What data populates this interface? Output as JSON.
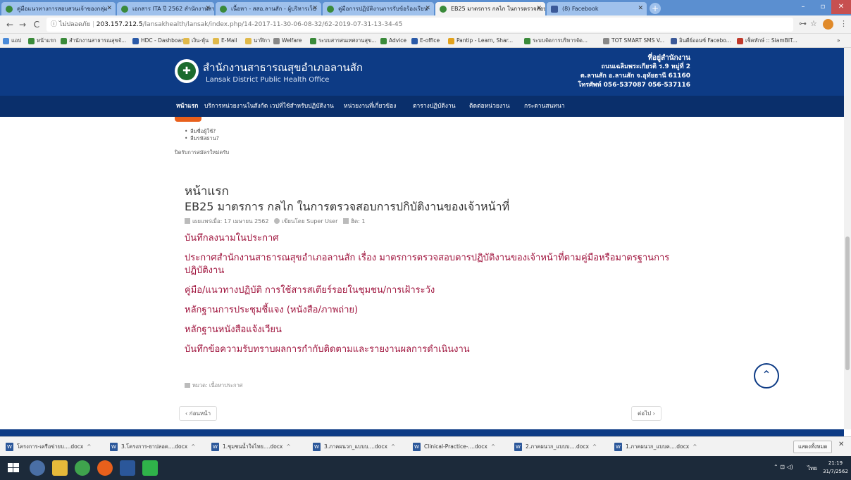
{
  "browser": {
    "tabs": [
      {
        "label": "คู่มือแนวทางการสอบสวนเจ้าของกลุ่ม",
        "fav": "site"
      },
      {
        "label": "เอกสาร ITA ปี 2562 สำนักงานสาธาร",
        "fav": "site"
      },
      {
        "label": "เนื้อหา - สสอ.ลานสัก - ผู้บริหารเว็บ",
        "fav": "site"
      },
      {
        "label": "คู่มือการปฏิบัติงานการรับข้อร้องเรียน",
        "fav": "site"
      },
      {
        "label": "EB25 มาตรการ กลไก ในการตรวจสอบ",
        "fav": "site"
      },
      {
        "label": "(8) Facebook",
        "fav": "fb"
      }
    ],
    "new_tab_symbol": "+",
    "window_controls": {
      "minimize": "–",
      "maximize": "▫",
      "close": "✕"
    },
    "nav": {
      "back": "←",
      "forward": "→",
      "reload": "C"
    },
    "url": {
      "security": "ⓘ ไม่ปลอดภัย",
      "host": "203.157.212.5",
      "path": "/lansakhealth/lansak/index.php/14-2017-11-30-06-08-32/62-2019-07-31-13-34-45"
    },
    "addr_icons": {
      "key": "⊶",
      "star": "☆",
      "menu": "⋮"
    },
    "bookmarks": [
      "แอป",
      "หน้าแรก",
      "สำนักงานสาธารณสุขจั...",
      "HDC - Dashboard",
      "เงิน-หุ้น",
      "E-Mail",
      "นาฬิกา",
      "Welfare",
      "ระบบสารสนเทศงานสุข...",
      "Advice",
      "E-office",
      "Pantip - Learn, Shar...",
      "ระบบจัดการบริหารจัด...",
      "TOT SMART SMS V...",
      "อินดีย์ออนซ์ Facebo...",
      "เช็คทักษ์ :: SiamBIT..."
    ],
    "bookmarks_more": "»"
  },
  "site": {
    "title": "สำนักงานสาธารณสุขอำเภอลานสัก",
    "subtitle": "Lansak District Public Health Office",
    "address": {
      "heading": "ที่อยู่สำนักงาน",
      "line1": "ถนนเฉลิมพระเกียรติ ร.9 หมู่ที่ 2",
      "line2": "ต.ลานสัก อ.ลานสัก จ.อุทัยธานี 61160",
      "line3": "โทรศัพท์ 056-537087 056-537116"
    },
    "nav": [
      "หน้าแรก",
      "บริการหน่วยงานในสังกัด",
      "เวปที่ใช้สำหรับปฏิบัติงาน",
      "หน่วยงานที่เกี่ยวข้อง",
      "ตารางปฏิบัติงาน",
      "ติดต่อหน่วยงาน",
      "กระดานสนทนา"
    ]
  },
  "login": {
    "forgot_username": "ลืมชื่อผู้ใช้?",
    "forgot_password": "ลืมรหัสผ่าน?",
    "register_note": "ปิดรับการสมัครใหม่ครับ"
  },
  "article": {
    "breadcrumb_title": "หน้าแรก",
    "title": "EB25 มาตรการ กลไก ในการตรวจสอบการปกิบัติงานของเจ้าหน้าที่",
    "published": "เผยแพร่เมื่อ: 17 เมษายน 2562",
    "author": "เขียนโดย Super User",
    "hits": "ฮิต: 1",
    "links": [
      "บันทึกลงนามในประกาศ",
      "ประกาศสำนักงานสาธารณสุขอำเภอลานสัก เรื่อง มาตรการตรวจสอบตารปฏิบัติงานของเจ้าหน้าที่ตามคู่มือหรือมาตรฐานการปฏิบัติงาน",
      "คู่มือ/แนวทางปฏิบัติ การใช้สารสเตียร์รอยในชุมชน/การเฝ้าระวัง",
      "หลักฐานการประชุมชี้แจง (หนังสือ/ภาพถ่าย)",
      "หลักฐานหนังสือแจ้งเวียน",
      "บันทึกข้อความรับทราบผลการกำกับติดตามและรายงานผลการดำเนินงาน"
    ],
    "category": "หมวด: เนื้อหาประกาศ",
    "prev": "‹ ก่อนหน้า",
    "next": "ต่อไป ›",
    "back_to_top": "⌃"
  },
  "downloads": {
    "items": [
      "โครงการ-เครือข่ายบ....docx",
      "3.โครงการ-ยาปลอด....docx",
      "1.ชุมชนน้ำใจไทย....docx",
      "3.ภาคผนวก_แบบบ....docx",
      "Clinical-Practice-....docx",
      "2.ภาคผนวก_แบบบ....docx",
      "1.ภาคผนวก_แบบค....docx"
    ],
    "caret": "^",
    "show_all": "แสดงทั้งหมด",
    "close": "✕"
  },
  "taskbar": {
    "time": "21:19",
    "date": "31/7/2562",
    "lang": "ไทย",
    "tray_icons": "⌃ ⊡ ◁)"
  },
  "colors": {
    "header_blue": "#0d3b85",
    "nav_blue": "#0a2f6b",
    "link_crimson": "#a0153e",
    "accent_orange": "#e8601c"
  }
}
